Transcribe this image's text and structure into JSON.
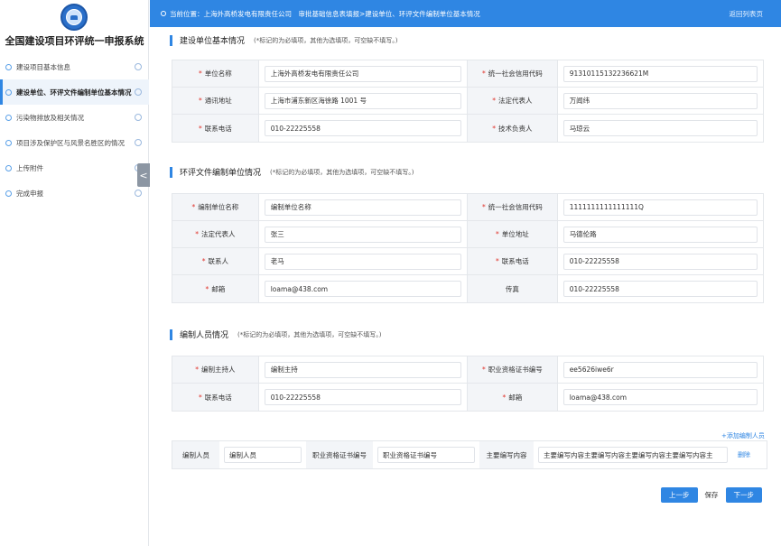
{
  "sidebar": {
    "title": "全国建设项目环评统一申报系统",
    "items": [
      {
        "label": "建设项目基本信息"
      },
      {
        "label": "建设单位、环评文件编制单位基本情况"
      },
      {
        "label": "污染物排放及相关情况"
      },
      {
        "label": "项目涉及保护区与风景名胜区的情况"
      },
      {
        "label": "上传附件"
      },
      {
        "label": "完成申报"
      }
    ],
    "collapse": "<"
  },
  "topbar": {
    "location": "当前位置：上海外高桥发电有限责任公司　审批基础信息表填报>建设单位、环评文件编制单位基本情况",
    "back": "返回列表页"
  },
  "section1": {
    "title": "建设单位基本情况",
    "note": "(*标记的为必填项，其他为选填项，可空缺不填写。)",
    "rows": [
      {
        "l1": "单位名称",
        "v1": "上海外高桥发电有限责任公司",
        "l2": "统一社会信用代码",
        "v2": "91310115132236621M"
      },
      {
        "l1": "通讯地址",
        "v1": "上海市浦东新区海徐路 1001 号",
        "l2": "法定代表人",
        "v2": "万闻纬"
      },
      {
        "l1": "联系电话",
        "v1": "010-22225558",
        "l2": "技术负责人",
        "v2": "马琼云"
      }
    ]
  },
  "section2": {
    "title": "环评文件编制单位情况",
    "note": "(*标记的为必填项，其他为选填项，可空缺不填写。)",
    "rows": [
      {
        "l1": "编制单位名称",
        "v1": "编制单位名称",
        "l2": "统一社会信用代码",
        "v2": "1111111111111111Q"
      },
      {
        "l1": "法定代表人",
        "v1": "张三",
        "l2": "单位地址",
        "v2": "马德伦路"
      },
      {
        "l1": "联系人",
        "v1": "老马",
        "l2": "联系电话",
        "v2": "010-22225558"
      },
      {
        "l1": "邮箱",
        "v1": "loama@438.com",
        "l2": "传真",
        "v2": "010-22225558"
      }
    ]
  },
  "section3": {
    "title": "编制人员情况",
    "note": "(*标记的为必填项，其他为选填项，可空缺不填写。)",
    "rows": [
      {
        "l1": "编制主持人",
        "v1": "编制主持",
        "l2": "职业资格证书编号",
        "v2": "ee5626iwe6r"
      },
      {
        "l1": "联系电话",
        "v1": "010-22225558",
        "l2": "邮箱",
        "v2": "loama@438.com"
      }
    ]
  },
  "staff": {
    "add": "+添加编制人员",
    "l1": "编制人员",
    "v1": "编制人员",
    "l2": "职业资格证书编号",
    "v2": "职业资格证书编号",
    "l3": "主要编写内容",
    "v3": "主要编写内容主要编写内容主要编写内容主要编写内容主",
    "delete": "删除"
  },
  "buttons": {
    "prev": "上一步",
    "save": "保存",
    "next": "下一步"
  },
  "colors": {
    "accent": "#2f86e3",
    "required": "#e0332b"
  }
}
